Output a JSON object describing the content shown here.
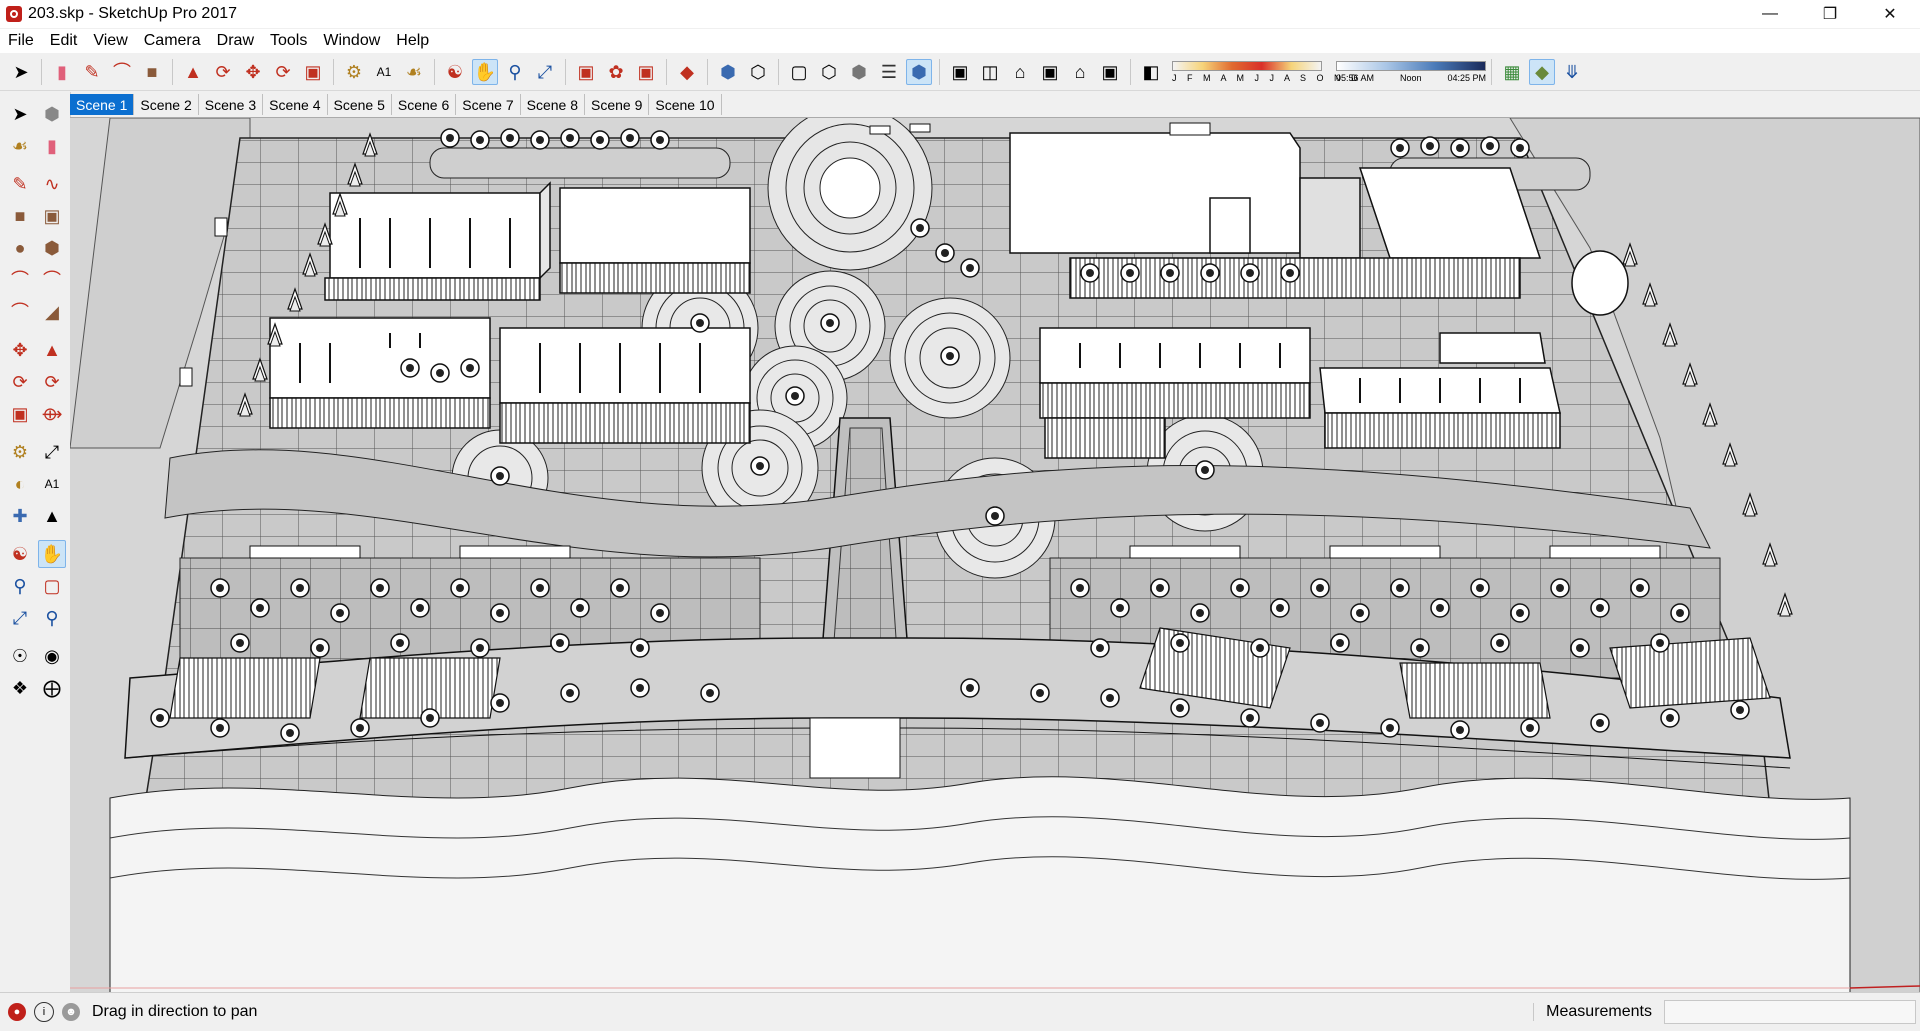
{
  "window": {
    "title": "203.skp - SketchUp Pro 2017",
    "controls": [
      "minimize",
      "restore",
      "close"
    ]
  },
  "menu": [
    "File",
    "Edit",
    "View",
    "Camera",
    "Draw",
    "Tools",
    "Window",
    "Help"
  ],
  "toolbar": {
    "months_label": "J F M A M J J A S O N D",
    "time_start": "05:56 AM",
    "time_mid": "Noon",
    "time_end": "04:25 PM"
  },
  "scenes": [
    "Scene 1",
    "Scene 2",
    "Scene 3",
    "Scene 4",
    "Scene 5",
    "Scene 6",
    "Scene 7",
    "Scene 8",
    "Scene 9",
    "Scene 10"
  ],
  "active_scene": "Scene 1",
  "status": {
    "message": "Drag in direction to pan",
    "measurements_label": "Measurements",
    "measurements_value": ""
  }
}
